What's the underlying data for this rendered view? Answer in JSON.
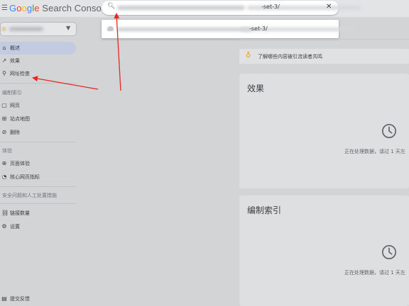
{
  "header": {
    "brand_google_letters": [
      "G",
      "o",
      "o",
      "g",
      "l",
      "e"
    ],
    "brand_rest": " Search Console"
  },
  "search": {
    "value_suffix": "-set-3/",
    "clear_glyph": "✕"
  },
  "suggestion": {
    "value_suffix": "-set-3/"
  },
  "sidebar": {
    "items": [
      {
        "label": "概述",
        "icon": "home-icon",
        "glyph": "⌂"
      },
      {
        "label": "效果",
        "icon": "trend-icon",
        "glyph": "↗"
      },
      {
        "label": "网址检查",
        "icon": "search-icon",
        "glyph": "⚲"
      }
    ],
    "section_index": "编制索引",
    "index_items": [
      {
        "label": "网页",
        "icon": "page-icon",
        "glyph": "▢"
      },
      {
        "label": "站点地图",
        "icon": "sitemap-icon",
        "glyph": "⊞"
      },
      {
        "label": "删除",
        "icon": "removal-icon",
        "glyph": "⊘"
      }
    ],
    "section_experience": "体验",
    "experience_items": [
      {
        "label": "页面体验",
        "icon": "experience-icon",
        "glyph": "⊕"
      },
      {
        "label": "核心网页指标",
        "icon": "vitals-icon",
        "glyph": "◔"
      }
    ],
    "section_security": "安全问题和人工处置措施",
    "other_items": [
      {
        "label": "链接数量",
        "icon": "links-icon",
        "glyph": "⛓"
      },
      {
        "label": "设置",
        "icon": "gear-icon",
        "glyph": "⚙"
      }
    ],
    "feedback": {
      "label": "提交反馈",
      "icon": "feedback-icon",
      "glyph": "▤"
    }
  },
  "main": {
    "info_text": "了解哪些内容被引流读者共鸣",
    "cards": [
      {
        "title": "效果",
        "status": "正在处理数据，请过 1 天左"
      },
      {
        "title": "编制索引",
        "status": "正在处理数据，请过 1 天左"
      }
    ]
  },
  "colors": {
    "accent_active": "#c2cbe0",
    "annotation_arrow": "#e8271f",
    "bulb": "#f29900"
  }
}
